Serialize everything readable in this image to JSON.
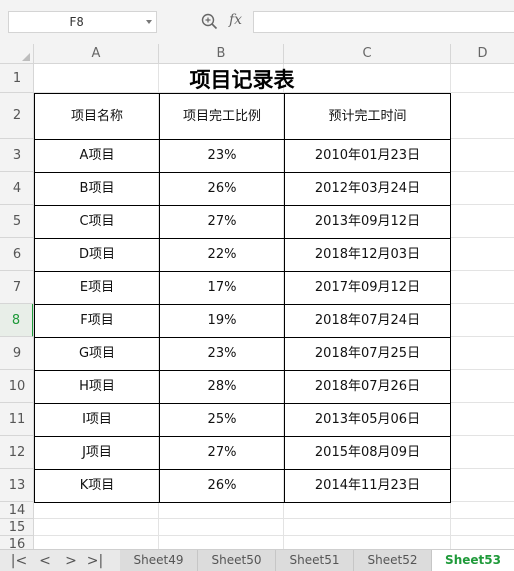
{
  "formula_bar": {
    "cell_ref": "F8",
    "formula": "",
    "fx_label": "fx"
  },
  "columns": [
    "A",
    "B",
    "C",
    "D"
  ],
  "rows": [
    "1",
    "2",
    "3",
    "4",
    "5",
    "6",
    "7",
    "8",
    "9",
    "10",
    "11",
    "12",
    "13",
    "14",
    "15",
    "16"
  ],
  "active_row": "8",
  "sheet": {
    "title": "项目记录表",
    "headers": [
      "项目名称",
      "项目完工比例",
      "预计完工时间"
    ],
    "records": [
      [
        "A项目",
        "23%",
        "2010年01月23日"
      ],
      [
        "B项目",
        "26%",
        "2012年03月24日"
      ],
      [
        "C项目",
        "27%",
        "2013年09月12日"
      ],
      [
        "D项目",
        "22%",
        "2018年12月03日"
      ],
      [
        "E项目",
        "17%",
        "2017年09月12日"
      ],
      [
        "F项目",
        "19%",
        "2018年07月24日"
      ],
      [
        "G项目",
        "23%",
        "2018年07月25日"
      ],
      [
        "H项目",
        "28%",
        "2018年07月26日"
      ],
      [
        "I项目",
        "25%",
        "2013年05月06日"
      ],
      [
        "J项目",
        "27%",
        "2015年08月09日"
      ],
      [
        "K项目",
        "26%",
        "2014年11月23日"
      ]
    ]
  },
  "tabs": {
    "nav": [
      "|<",
      "<",
      ">",
      ">|"
    ],
    "sheets": [
      "Sheet49",
      "Sheet50",
      "Sheet51",
      "Sheet52",
      "Sheet53"
    ],
    "active": "Sheet53"
  },
  "colors": {
    "accent": "#1f9a3a",
    "grid": "#e3e3e3",
    "header_bg": "#f3f3f3"
  }
}
